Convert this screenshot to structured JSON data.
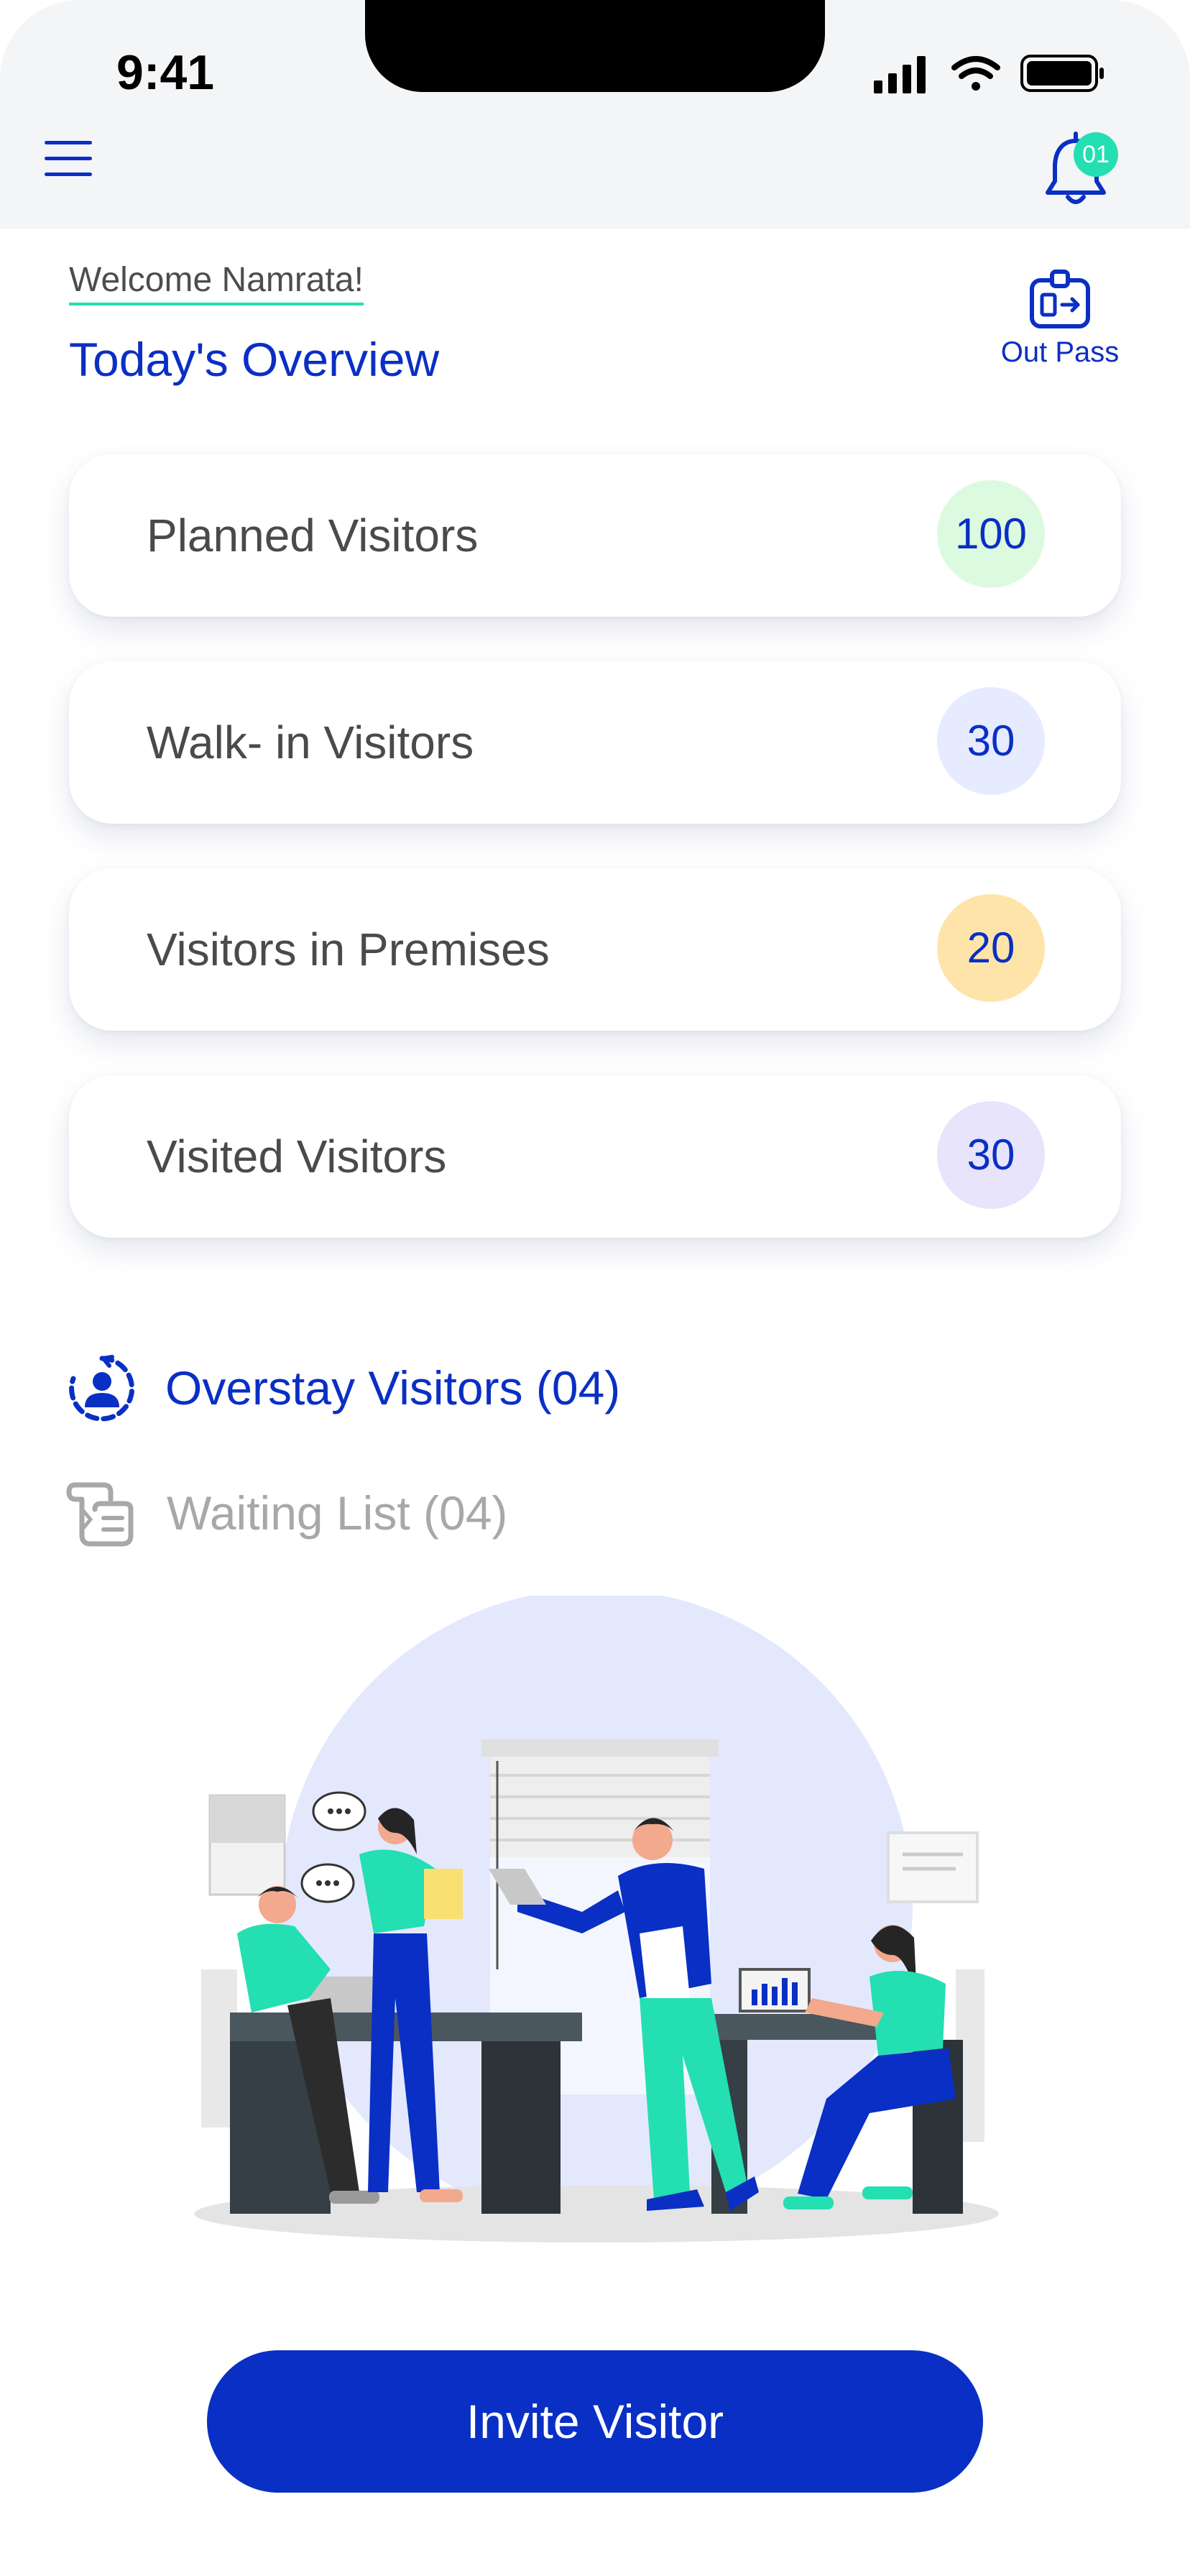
{
  "status_bar": {
    "time": "9:41"
  },
  "header": {
    "notification_count": "01"
  },
  "greeting": "Welcome Namrata!",
  "section_title": "Today's Overview",
  "out_pass_label": "Out Pass",
  "stats": [
    {
      "label": "Planned Visitors",
      "count": "100",
      "badge_color": "#dcfadf"
    },
    {
      "label": "Walk- in Visitors",
      "count": "30",
      "badge_color": "#e6ebff"
    },
    {
      "label": "Visitors in Premises",
      "count": "20",
      "badge_color": "#ffe4aa"
    },
    {
      "label": "Visited Visitors",
      "count": "30",
      "badge_color": "#e7e4fb"
    }
  ],
  "links": {
    "overstay": "Overstay Visitors (04)",
    "waiting": "Waiting List (04)"
  },
  "primary_button": "Invite Visitor",
  "colors": {
    "brand": "#0a2fc4",
    "accent": "#23dfb1",
    "muted_text": "#a8a8a8"
  },
  "icons": [
    "menu-icon",
    "bell-icon",
    "id-card-icon",
    "overstay-clock-icon",
    "waiting-list-icon"
  ]
}
